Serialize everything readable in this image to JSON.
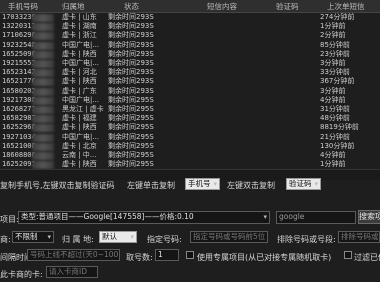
{
  "columns": [
    "手机号码",
    "归属地",
    "状态",
    "短信内容",
    "验证码",
    "上次单短信"
  ],
  "rows": [
    {
      "phone": "17033239",
      "loc": "虚卡 | 山东",
      "status": "剩余时间293S",
      "mins": "274分钟前"
    },
    {
      "phone": "13220311",
      "loc": "虚卡 | 湖南",
      "status": "剩余时间293S",
      "mins": "1分钟前"
    },
    {
      "phone": "17106290",
      "loc": "虚卡 | 浙江",
      "status": "剩余时间293S",
      "mins": "2分钟前"
    },
    {
      "phone": "19232548",
      "loc": "中国广电|...",
      "status": "剩余时间293S",
      "mins": "85分钟前"
    },
    {
      "phone": "16525096",
      "loc": "虚卡 | 陕西",
      "status": "剩余时间293S",
      "mins": "23分钟前"
    },
    {
      "phone": "19215553",
      "loc": "中国广电|...",
      "status": "剩余时间293S",
      "mins": "3分钟前"
    },
    {
      "phone": "16523142",
      "loc": "虚卡 | 河北",
      "status": "剩余时间293S",
      "mins": "33分钟前"
    },
    {
      "phone": "16521776",
      "loc": "虚卡 | 陕西",
      "status": "剩余时间293S",
      "mins": "367分钟前"
    },
    {
      "phone": "16580202",
      "loc": "虚卡 | 广东",
      "status": "剩余时间293S",
      "mins": "3分钟前"
    },
    {
      "phone": "19217308",
      "loc": "中国广电|...",
      "status": "剩余时间295S",
      "mins": "4分钟前"
    },
    {
      "phone": "16268271",
      "loc": "黑龙江 | 虚卡",
      "status": "剩余时间295S",
      "mins": "31分钟前"
    },
    {
      "phone": "16582987",
      "loc": "虚卡 | 福建",
      "status": "剩余时间295S",
      "mins": "48分钟前"
    },
    {
      "phone": "16252968",
      "loc": "虚卡 | 陕西",
      "status": "剩余时间295S",
      "mins": "8819分钟前"
    },
    {
      "phone": "19271034",
      "loc": "中国广电|...",
      "status": "剩余时间295S",
      "mins": "21分钟前"
    },
    {
      "phone": "16521008",
      "loc": "虚卡 | 北京",
      "status": "剩余时间295S",
      "mins": "130分钟前"
    },
    {
      "phone": "18608800",
      "loc": "云南 | 中...",
      "status": "剩余时间295S",
      "mins": "4分钟前"
    },
    {
      "phone": "16252091",
      "loc": "虚卡 | 陕西",
      "status": "剩余时间295S",
      "mins": "1分钟前"
    }
  ],
  "controls": {
    "copy_hint": "复制手机号,左键双击复制验证码",
    "left_click_copy": "左键单击复制",
    "left_click_value": "手机号",
    "left_double_copy": "左键双击复制",
    "left_double_value": "验证码",
    "project_label": "项目:",
    "project_value": "类型:普通项目——Google[147558]——价格:0.10",
    "project_search_placeholder": "google",
    "search_button": "搜索项",
    "operator_label": "商:",
    "operator_value": "不限制",
    "location_label": "归 属 地:",
    "location_value": "默认",
    "specified_number_label": "指定号码:",
    "specified_number_placeholder": "指定号码或号码前5位",
    "exclude_label": "排除号码或号段:",
    "exclude_placeholder": "排除号码或",
    "interval_label": "间隔时间:",
    "interval_placeholder": "号码上线不超过(天0~100)",
    "count_label": "取号数:",
    "count_value": "1",
    "specify_checkbox_label": "使用专属项目(从已对接专属随机取卡)",
    "filter_checkbox_label": "过滤已使",
    "card_merchant_label": "此卡商的卡:",
    "card_merchant_placeholder": "请入卡商ID"
  }
}
